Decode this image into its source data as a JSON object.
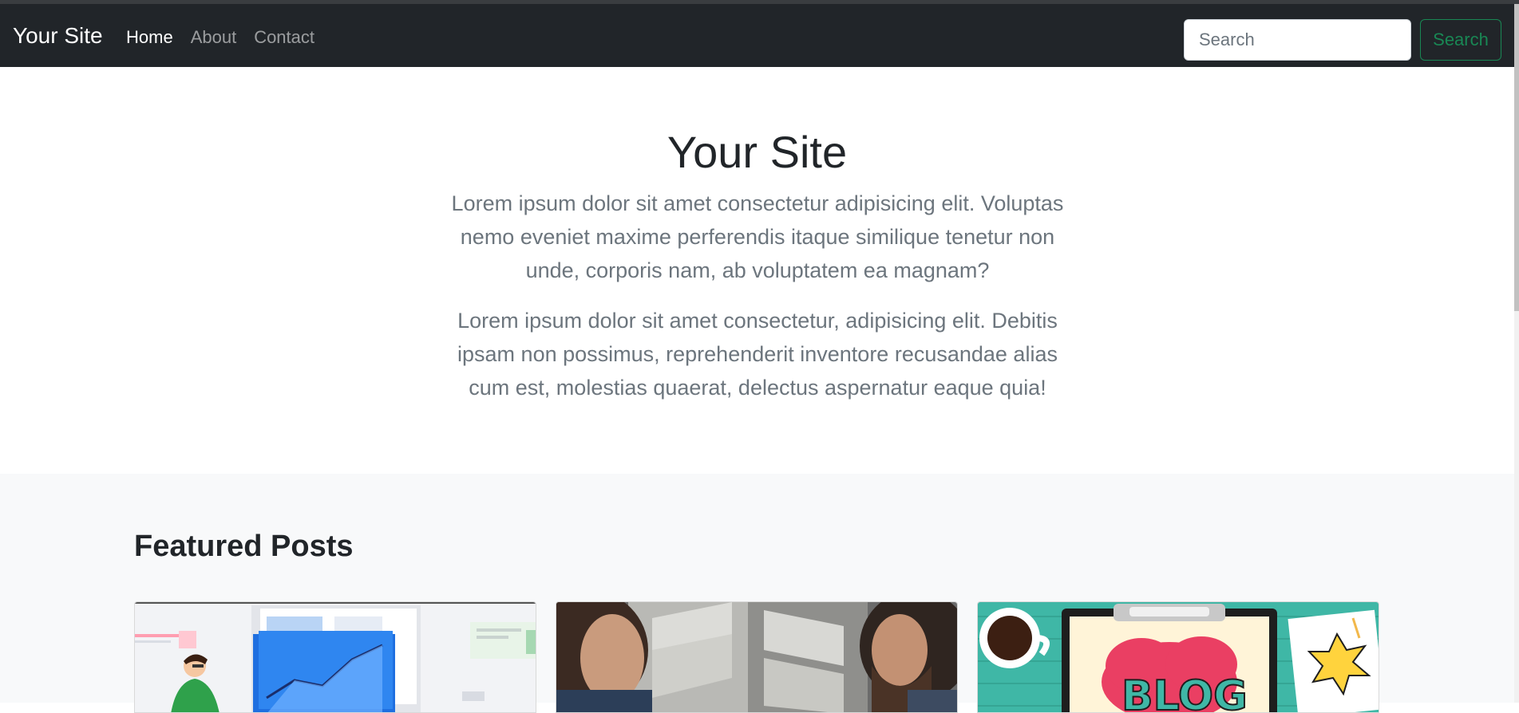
{
  "navbar": {
    "brand": "Your Site",
    "links": [
      {
        "label": "Home",
        "active": true
      },
      {
        "label": "About",
        "active": false
      },
      {
        "label": "Contact",
        "active": false
      }
    ],
    "search": {
      "placeholder": "Search",
      "button_label": "Search"
    }
  },
  "hero": {
    "title": "Your Site",
    "paragraphs": [
      "Lorem ipsum dolor sit amet consectetur adipisicing elit. Voluptas nemo eveniet maxime perferendis itaque similique tenetur non unde, corporis nam, ab voluptatem ea magnam?",
      "Lorem ipsum dolor sit amet consectetur, adipisicing elit. Debitis ipsam non possimus, reprehenderit inventore recusandae alias cum est, molestias quaerat, delectus aspernatur eaque quia!"
    ]
  },
  "featured": {
    "title": "Featured Posts",
    "cards": [
      {
        "image": "analytics-illustration"
      },
      {
        "image": "people-photo"
      },
      {
        "image": "blog-illustration"
      }
    ]
  },
  "colors": {
    "navbar_bg": "#212529",
    "search_accent": "#198754",
    "featured_bg": "#f8f9fa"
  }
}
